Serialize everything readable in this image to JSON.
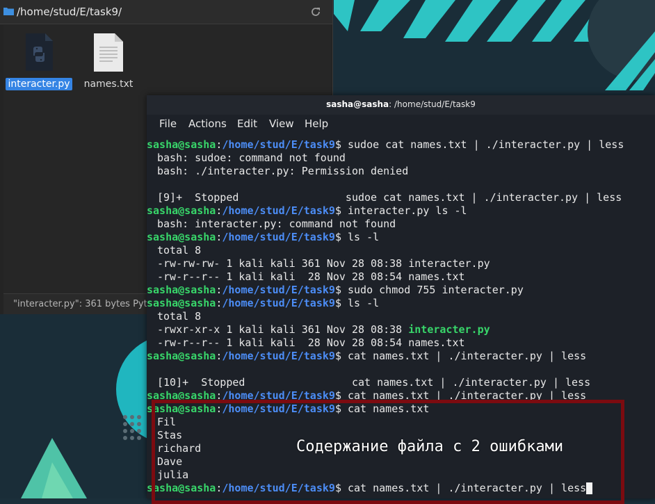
{
  "file_manager": {
    "path": "/home/stud/E/task9/",
    "files": [
      {
        "name": "interacter.py",
        "icon": "python-file-icon",
        "selected": true
      },
      {
        "name": "names.txt",
        "icon": "text-file-icon",
        "selected": false
      }
    ],
    "status": "\"interacter.py\": 361 bytes Pyt"
  },
  "terminal": {
    "title_user": "sasha@sasha",
    "title_path": ": /home/stud/E/task9",
    "menu": [
      "File",
      "Actions",
      "Edit",
      "View",
      "Help"
    ],
    "prompt_user": "sasha@sasha",
    "prompt_path": "/home/stud/E/task9",
    "lines": [
      {
        "type": "prompt",
        "cmd": " sudoe cat names.txt | ./interacter.py | less"
      },
      {
        "type": "out",
        "text": "bash: sudoe: command not found"
      },
      {
        "type": "out",
        "text": "bash: ./interacter.py: Permission denied"
      },
      {
        "type": "out",
        "text": ""
      },
      {
        "type": "out",
        "text": "[9]+  Stopped                 sudoe cat names.txt | ./interacter.py | less"
      },
      {
        "type": "prompt",
        "cmd": " interacter.py ls -l"
      },
      {
        "type": "out",
        "text": "bash: interacter.py: command not found"
      },
      {
        "type": "prompt",
        "cmd": " ls -l"
      },
      {
        "type": "out",
        "text": "total 8"
      },
      {
        "type": "out",
        "text": "-rw-rw-rw- 1 kali kali 361 Nov 28 08:38 interacter.py"
      },
      {
        "type": "out",
        "text": "-rw-r--r-- 1 kali kali  28 Nov 28 08:54 names.txt"
      },
      {
        "type": "prompt",
        "cmd": " sudo chmod 755 interacter.py"
      },
      {
        "type": "prompt",
        "cmd": " ls -l"
      },
      {
        "type": "out",
        "text": "total 8"
      },
      {
        "type": "exec",
        "text": "-rwxr-xr-x 1 kali kali 361 Nov 28 08:38 ",
        "name": "interacter.py"
      },
      {
        "type": "out",
        "text": "-rw-r--r-- 1 kali kali  28 Nov 28 08:54 names.txt"
      },
      {
        "type": "prompt",
        "cmd": " cat names.txt | ./interacter.py | less"
      },
      {
        "type": "out",
        "text": ""
      },
      {
        "type": "out",
        "text": "[10]+  Stopped                 cat names.txt | ./interacter.py | less"
      },
      {
        "type": "prompt",
        "cmd": " cat names.txt | ./interacter.py | less"
      },
      {
        "type": "prompt",
        "cmd": " cat names.txt"
      },
      {
        "type": "out",
        "text": "Fil"
      },
      {
        "type": "out",
        "text": "Stas"
      },
      {
        "type": "out",
        "text": "richard"
      },
      {
        "type": "out",
        "text": "Dave"
      },
      {
        "type": "out",
        "text": "julia"
      },
      {
        "type": "prompt",
        "cmd": " cat names.txt | ./interacter.py | less",
        "cursor": true
      }
    ]
  },
  "annotation": {
    "text": "Содержание файла с 2 ошибками",
    "color": "#7c0b10"
  },
  "colors": {
    "prompt_user": "#38d66a",
    "prompt_path": "#4c8df6",
    "selection": "#3584e4",
    "desktop_accent": "#2ec4c4"
  }
}
